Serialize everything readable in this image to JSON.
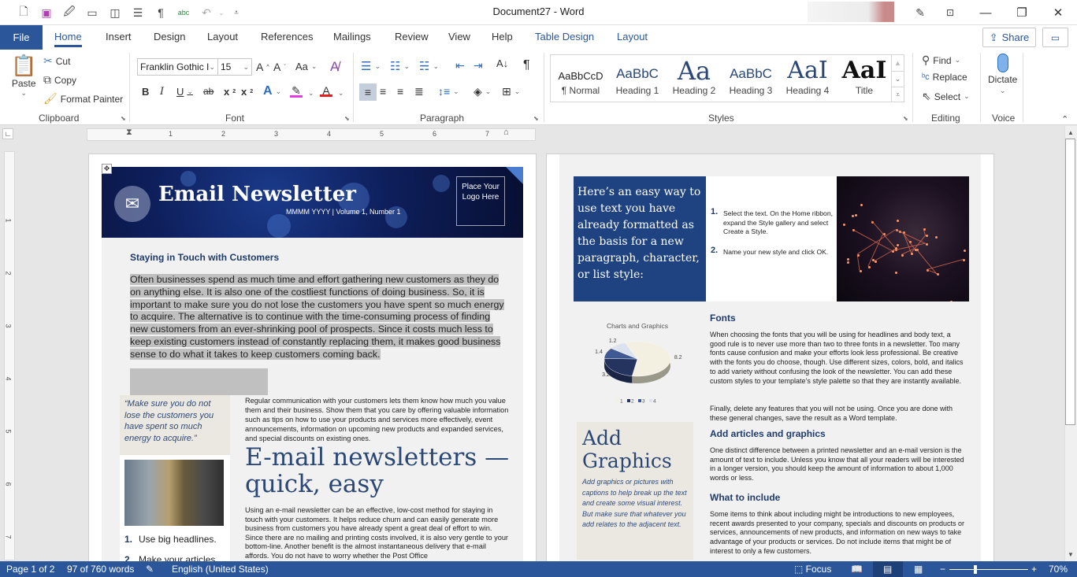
{
  "window": {
    "title": "Document27  -  Word",
    "quick_access": [
      "new-document-icon",
      "save-icon",
      "save-as-icon",
      "open-folder-icon",
      "read-mode-icon",
      "layout-icon",
      "pilcrow-icon",
      "spelling-icon",
      "undo-icon",
      "customize-icon"
    ],
    "controls": {
      "minimize": "—",
      "restore": "❐",
      "close": "✕"
    }
  },
  "tabs": {
    "file": "File",
    "items": [
      "Home",
      "Insert",
      "Design",
      "Layout",
      "References",
      "Mailings",
      "Review",
      "View",
      "Help"
    ],
    "contextual": [
      "Table Design",
      "Layout"
    ],
    "active": "Home",
    "share": "Share"
  },
  "ribbon": {
    "clipboard": {
      "paste": "Paste",
      "cut": "Cut",
      "copy": "Copy",
      "format_painter": "Format Painter",
      "label": "Clipboard"
    },
    "font": {
      "name": "Franklin Gothic I",
      "size": "15",
      "label": "Font",
      "highlight_color": "#e63ce6",
      "font_color": "#e02020"
    },
    "paragraph": {
      "label": "Paragraph"
    },
    "styles": {
      "label": "Styles",
      "items": [
        {
          "preview": "AaBbCcD",
          "name": "¶ Normal"
        },
        {
          "preview": "AaBbC",
          "name": "Heading 1"
        },
        {
          "preview": "Aa",
          "name": "Heading 2"
        },
        {
          "preview": "AaBbC",
          "name": "Heading 3"
        },
        {
          "preview": "AaI",
          "name": "Heading 4"
        },
        {
          "preview": "AaI",
          "name": "Title"
        }
      ]
    },
    "editing": {
      "find": "Find",
      "replace": "Replace",
      "select": "Select",
      "label": "Editing"
    },
    "voice": {
      "dictate": "Dictate",
      "label": "Voice"
    }
  },
  "ruler": {
    "h_numbers": [
      "1",
      "2",
      "3",
      "4",
      "5",
      "6",
      "7"
    ],
    "v_numbers": [
      "1",
      "2",
      "3",
      "4",
      "5",
      "6",
      "7"
    ]
  },
  "page1": {
    "banner": {
      "title": "Email Newsletter",
      "subtitle": "MMMM YYYY  |  Volume 1, Number 1",
      "logo": "Place Your Logo Here"
    },
    "heading": "Staying in Touch with Customers",
    "intro": "Often businesses spend as much time and effort gathering new customers as they do on anything else. It is also one of the costliest functions of doing business. So, it is important to make sure you do not lose the customers you have spent so much energy to acquire. The alternative is to continue with the time-consuming process of finding new customers from an ever-shrinking pool of prospects. Since it costs much less to keep existing customers instead of constantly replacing them, it makes good business sense to do what it takes to keep customers coming back.",
    "quote": "“Make sure you do not lose the customers you have spent so much energy to acquire.”",
    "regular_para": "Regular communication with your customers lets them know how much you value them and their business. Show them that you care by offering valuable information such as tips on how to use your products and services more effectively, event announcements, information on upcoming new products and expanded services, and special discounts on existing ones.",
    "big_heading": "E-mail newsletters — quick, easy",
    "using_para": "Using an e-mail newsletter can be an effective, low-cost method for staying in touch with your customers. It helps reduce churn and can easily generate more business from customers you have already spent a great deal of effort to win. Since there are no mailing and printing costs involved, it is also very gentle to your bottom-line. Another benefit is the almost instantaneous delivery that e-mail affords. You do not have to worry whether the Post Office",
    "list": [
      {
        "num": "1.",
        "text": "Use big headlines."
      },
      {
        "num": "2.",
        "text": "Make your articles"
      }
    ]
  },
  "page2": {
    "tip": "Here’s an easy way to use text you have already formatted as the basis for a new paragraph, character, or list style:",
    "steps": [
      {
        "num": "1.",
        "text": "Select the text. On the Home ribbon, expand the Style gallery and select Create a Style."
      },
      {
        "num": "2.",
        "text": "Name your new style and click OK."
      }
    ],
    "fonts_heading": "Fonts",
    "fonts_text1": "When choosing the fonts that you will be using for headlines and body text, a good rule is to never use more than two to three fonts in a newsletter. Too many fonts cause confusion and make your efforts look less professional. Be creative with the fonts you do choose, though. Use different sizes, colors, bold, and italics to add variety without confusing the look of the newsletter. You can add these custom styles to your template’s style palette so that they are instantly available.",
    "fonts_text2": "Finally, delete any features that you will not be using. Once you are done with these general changes, save the result as a Word template.",
    "add_heading": "Add articles and graphics",
    "add_text": "One distinct difference between a printed newsletter and an e-mail version is the amount of text to include. Unless you know that all your readers will be interested in a longer version, you should keep the amount of information to about 1,000 words or less.",
    "what_heading": "What to include",
    "what_text": "Some items to think about including might be introductions to new employees, recent awards presented to your company, specials and discounts on products or services, announcements of new products, and information on new ways to take advantage of your products or services. Do not include items that might be of interest to only a few customers.",
    "add_graphics_title": "Add Graphics",
    "add_graphics_text": "Add graphics or pictures with captions to help break up the text and create some visual interest. But make sure that whatever you add relates to the adjacent text."
  },
  "chart_data": {
    "type": "pie",
    "title": "Charts and Graphics",
    "categories": [
      "1",
      "2",
      "3",
      "4"
    ],
    "values": [
      8.2,
      3.2,
      1.4,
      1.2
    ],
    "colors": [
      "#f3f0e2",
      "#25335f",
      "#3f5a93",
      "#dde3ee"
    ],
    "legend": "bottom"
  },
  "status": {
    "page": "Page 1 of 2",
    "words": "97 of 760 words",
    "language": "English (United States)",
    "focus": "Focus",
    "zoom": "70%",
    "zoom_value": 70
  }
}
